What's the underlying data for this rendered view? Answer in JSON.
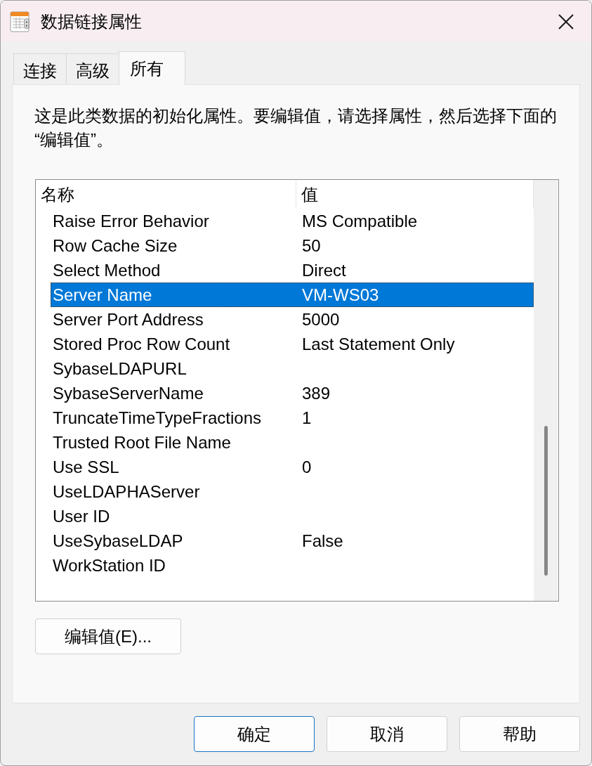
{
  "window": {
    "title": "数据链接属性"
  },
  "tabs": [
    {
      "label": "连接",
      "selected": false
    },
    {
      "label": "高级",
      "selected": false
    },
    {
      "label": "所有",
      "selected": true
    }
  ],
  "description": "这是此类数据的初始化属性。要编辑值，请选择属性，然后选择下面的“编辑值”。",
  "property_list": {
    "columns": [
      "名称",
      "值"
    ],
    "rows": [
      {
        "name": "Raise Error Behavior",
        "value": "MS Compatible",
        "selected": false
      },
      {
        "name": "Row Cache Size",
        "value": "50",
        "selected": false
      },
      {
        "name": "Select Method",
        "value": "Direct",
        "selected": false
      },
      {
        "name": "Server Name",
        "value": "VM-WS03",
        "selected": true
      },
      {
        "name": "Server Port Address",
        "value": "5000",
        "selected": false
      },
      {
        "name": "Stored Proc Row Count",
        "value": "Last Statement Only",
        "selected": false
      },
      {
        "name": "SybaseLDAPURL",
        "selected": false
      },
      {
        "name": "SybaseServerName",
        "value": "389",
        "selected": false
      },
      {
        "name": "TruncateTimeTypeFractions",
        "value": "1",
        "selected": false
      },
      {
        "name": "Trusted Root File Name",
        "selected": false
      },
      {
        "name": "Use SSL",
        "value": "0",
        "selected": false
      },
      {
        "name": "UseLDAPHAServer",
        "selected": false
      },
      {
        "name": "User ID",
        "selected": false
      },
      {
        "name": "UseSybaseLDAP",
        "value": "False",
        "selected": false
      },
      {
        "name": "WorkStation ID",
        "selected": false
      }
    ]
  },
  "edit_button": {
    "label": "编辑值(E)..."
  },
  "buttons": [
    {
      "label": "确定",
      "default": true
    },
    {
      "label": "取消",
      "default": false
    },
    {
      "label": "帮助",
      "default": false
    }
  ]
}
